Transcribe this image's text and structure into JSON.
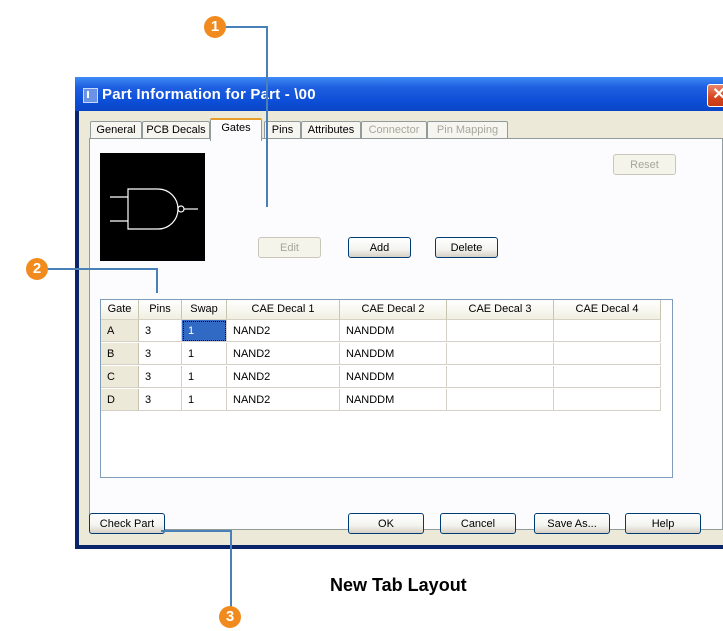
{
  "window": {
    "title": "Part Information for Part - \\00",
    "close_glyph": "✕"
  },
  "tabs": [
    {
      "label": "General",
      "state": "normal"
    },
    {
      "label": "PCB Decals",
      "state": "normal"
    },
    {
      "label": "Gates",
      "state": "active"
    },
    {
      "label": "Pins",
      "state": "normal"
    },
    {
      "label": "Attributes",
      "state": "normal"
    },
    {
      "label": "Connector",
      "state": "disabled"
    },
    {
      "label": "Pin Mapping",
      "state": "disabled"
    }
  ],
  "gate_preview": {
    "icon": "nand-gate-symbol"
  },
  "buttons": {
    "reset": "Reset",
    "edit": "Edit",
    "add": "Add",
    "delete": "Delete",
    "check_part": "Check Part",
    "ok": "OK",
    "cancel": "Cancel",
    "save_as": "Save As...",
    "help": "Help"
  },
  "grid": {
    "columns": [
      "Gate",
      "Pins",
      "Swap",
      "CAE Decal 1",
      "CAE Decal 2",
      "CAE Decal 3",
      "CAE Decal 4"
    ],
    "rows": [
      {
        "gate": "A",
        "pins": "3",
        "swap": "1",
        "decal1": "NAND2",
        "decal2": "NANDDM",
        "decal3": "",
        "decal4": ""
      },
      {
        "gate": "B",
        "pins": "3",
        "swap": "1",
        "decal1": "NAND2",
        "decal2": "NANDDM",
        "decal3": "",
        "decal4": ""
      },
      {
        "gate": "C",
        "pins": "3",
        "swap": "1",
        "decal1": "NAND2",
        "decal2": "NANDDM",
        "decal3": "",
        "decal4": ""
      },
      {
        "gate": "D",
        "pins": "3",
        "swap": "1",
        "decal1": "NAND2",
        "decal2": "NANDDM",
        "decal3": "",
        "decal4": ""
      }
    ]
  },
  "callouts": [
    "1",
    "2",
    "3"
  ],
  "caption": "New Tab Layout",
  "colors": {
    "accent_callout": "#f28b1e",
    "callout_line": "#4a80b8",
    "title_bar": "#0d4fd8",
    "selection": "#316ac5"
  }
}
